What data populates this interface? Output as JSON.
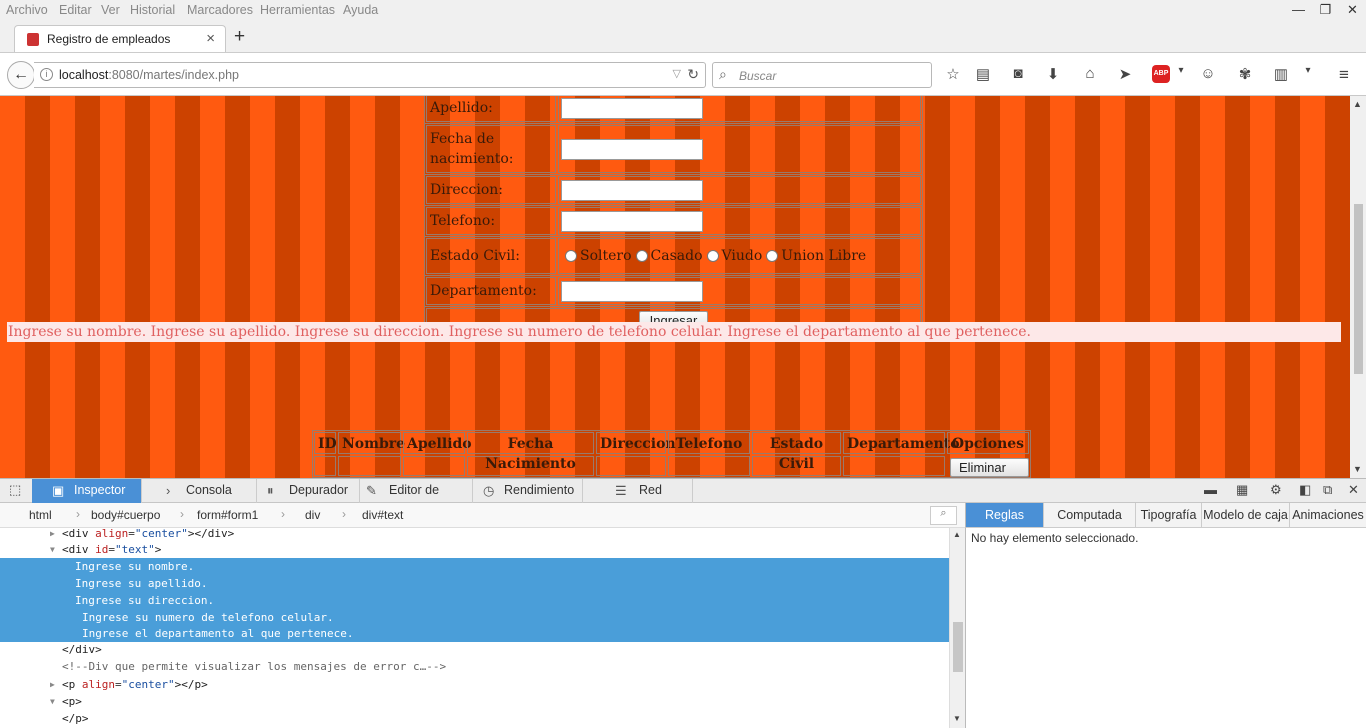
{
  "menu": [
    "Archivo",
    "Editar",
    "Ver",
    "Historial",
    "Marcadores",
    "Herramientas",
    "Ayuda"
  ],
  "tab": {
    "title": "Registro de empleados"
  },
  "nav": {
    "url_host": "localhost",
    "url_path": ":8080/martes/index.php",
    "search_placeholder": "Buscar"
  },
  "form": {
    "labels": {
      "apellido": "Apellido:",
      "fecha_1": "Fecha de",
      "fecha_2": "nacimiento:",
      "direccion": "Direccion:",
      "telefono": "Telefono:",
      "estado_civil": "Estado Civil:",
      "departamento": "Departamento:"
    },
    "radios": [
      "Soltero",
      "Casado",
      "Viudo",
      "Union Libre"
    ],
    "submit": "Ingresar"
  },
  "message": "Ingrese su nombre. Ingrese su apellido. Ingrese su direccion. Ingrese su numero de telefono celular. Ingrese el departamento al que pertenece.",
  "employees": {
    "headers": [
      "ID",
      "Nombre",
      "Apellido",
      "Fecha Nacimiento",
      "Direccion",
      "Telefono",
      "Estado Civil",
      "Departamento",
      "Opciones"
    ],
    "delete_label": "Eliminar"
  },
  "devtools": {
    "tabs": [
      "Inspector",
      "Consola",
      "Depurador",
      "Editor de esti...",
      "Rendimiento",
      "Red"
    ],
    "breadcrumb": [
      "html",
      "body#cuerpo",
      "form#form1",
      "div",
      "div#text"
    ],
    "side_tabs": [
      "Reglas",
      "Computada",
      "Tipografía",
      "Modelo de caja",
      "Animaciones"
    ],
    "side_empty": "No hay elemento seleccionado.",
    "markup": {
      "l1": {
        "tag1": "<div ",
        "attr": "align",
        "val": "\"center\"",
        "tag2": "></div>"
      },
      "l2": {
        "tag1": "<div ",
        "attr": "id",
        "val": "\"text\"",
        "tag2": ">"
      },
      "l3": "Ingrese su nombre.",
      "l4": "Ingrese su apellido.",
      "l5": "Ingrese su direccion.",
      "l6": "Ingrese su numero de telefono celular.",
      "l7": "Ingrese el departamento al que pertenece.",
      "l8": "</div>",
      "l9": "<!--Div que permite visualizar los mensajes de error c…-->",
      "l10": {
        "tag1": "<p ",
        "attr": "align",
        "val": "\"center\"",
        "tag2": "></p>"
      },
      "l11": "<p>",
      "l12": "</p>"
    }
  }
}
